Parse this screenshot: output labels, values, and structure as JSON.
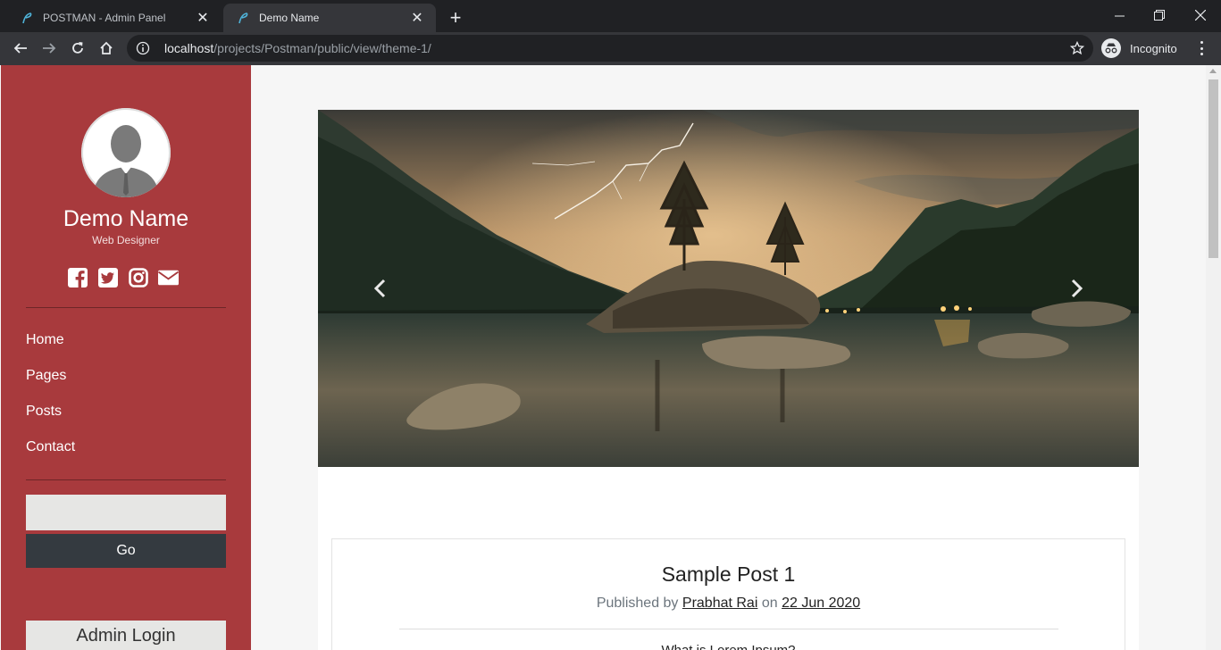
{
  "browser": {
    "tabs": [
      {
        "title": "POSTMAN - Admin Panel",
        "active": false
      },
      {
        "title": "Demo Name",
        "active": true
      }
    ],
    "url_host": "localhost",
    "url_path": "/projects/Postman/public/view/theme-1/",
    "profile_label": "Incognito"
  },
  "sidebar": {
    "name": "Demo Name",
    "role": "Web Designer",
    "socials": [
      "facebook-icon",
      "twitter-icon",
      "instagram-icon",
      "envelope-icon"
    ],
    "nav": [
      "Home",
      "Pages",
      "Posts",
      "Contact"
    ],
    "search_placeholder": "",
    "go_label": "Go",
    "admin_login_label": "Admin Login"
  },
  "post": {
    "title": "Sample Post 1",
    "published_by_label": "Published by",
    "author": "Prabhat Rai",
    "on_label": "on",
    "date": "22 Jun 2020",
    "excerpt": "What is Lorem Ipsum?"
  },
  "colors": {
    "sidebar_bg": "#a83a3d",
    "go_button_bg": "#343a40"
  }
}
